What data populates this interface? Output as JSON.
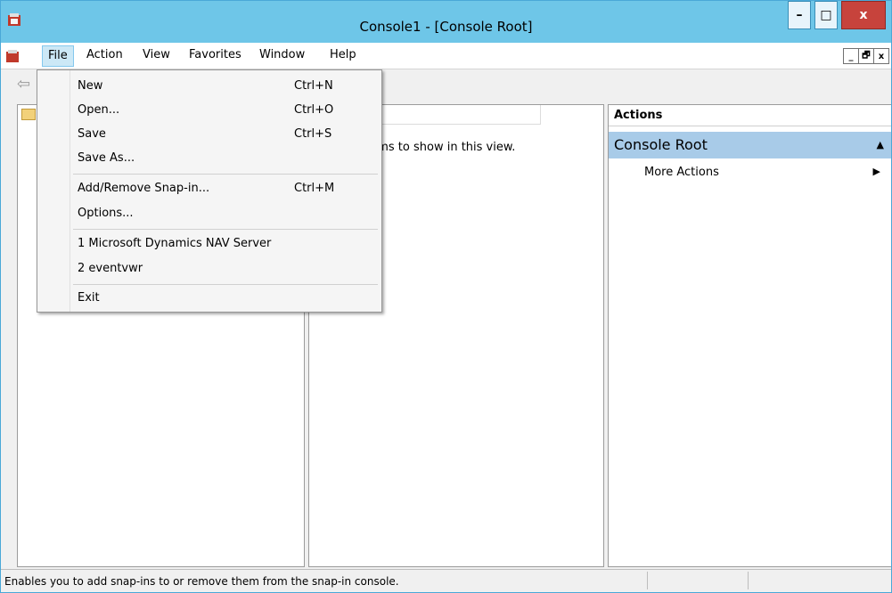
{
  "window": {
    "title": "Console1 - [Console Root]",
    "accent": "#6ec6e8",
    "close_glyph": "x",
    "min_glyph": "–",
    "max_glyph": "□"
  },
  "menubar": {
    "items": [
      "File",
      "Action",
      "View",
      "Favorites",
      "Window",
      "Help"
    ],
    "mdi_buttons": [
      "_",
      "🗗",
      "x"
    ]
  },
  "file_menu": {
    "items": [
      {
        "label": "New",
        "shortcut": "Ctrl+N"
      },
      {
        "label": "Open...",
        "shortcut": "Ctrl+O"
      },
      {
        "label": "Save",
        "shortcut": "Ctrl+S"
      },
      {
        "label": "Save As...",
        "shortcut": ""
      },
      {
        "label": "Add/Remove Snap-in...",
        "shortcut": "Ctrl+M"
      },
      {
        "label": "Options...",
        "shortcut": ""
      },
      {
        "label": "1 Microsoft Dynamics NAV Server",
        "shortcut": ""
      },
      {
        "label": "2 eventvwr",
        "shortcut": ""
      },
      {
        "label": "Exit",
        "shortcut": ""
      }
    ]
  },
  "middle_pane": {
    "empty_message": "re no items to show in this view."
  },
  "actions_pane": {
    "header": "Actions",
    "section": "Console Root",
    "more_actions": "More Actions",
    "section_color": "#a8cbe8"
  },
  "statusbar": {
    "message": "Enables you to add snap-ins to or remove them from the snap-in console."
  }
}
